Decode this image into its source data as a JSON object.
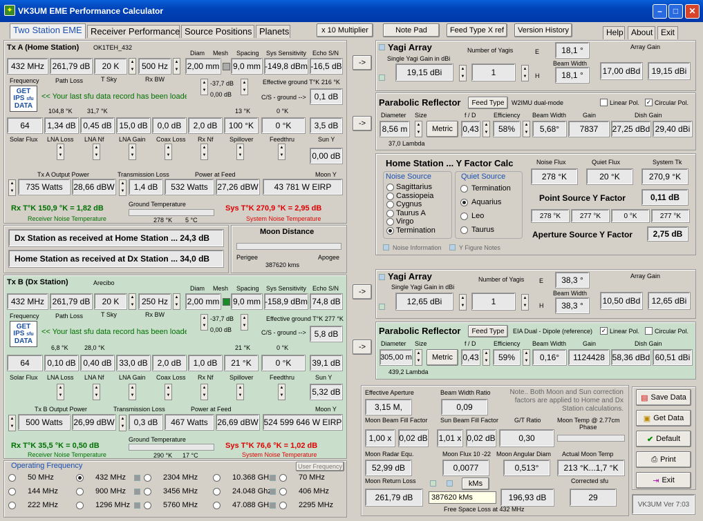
{
  "window": {
    "title": "VK3UM EME Performance Calculator",
    "icon": "app-icon"
  },
  "tabs": [
    "Two Station EME",
    "Receiver Performance",
    "Source Positions",
    "Planets"
  ],
  "toolbar": {
    "mult": "x 10 Multiplier",
    "notepad": "Note Pad",
    "feed": "Feed Type X ref",
    "version": "Version History"
  },
  "menu": {
    "help": "Help",
    "about": "About",
    "exit": "Exit"
  },
  "tx_a": {
    "title": "Tx A (Home Station)",
    "callsign": "OK1TEH_432",
    "h_diam": "Diam",
    "h_mesh": "Mesh",
    "h_spacing": "Spacing",
    "h_sens": "Sys Sensitivity",
    "h_echo": "Echo S/N",
    "freq": "432 MHz",
    "pathloss": "261,79 dB",
    "tsky": "20 K",
    "rxbw": "500 Hz",
    "diam": "2,00 mm",
    "spacing": "9,0 mm",
    "sens": "-149,8 dBm",
    "echo": "-16,5 dB",
    "l_freq": "Frequency",
    "l_path": "Path Loss",
    "l_tsky": "T Sky",
    "l_rxbw": "Rx BW",
    "eff_a": "-37,7 dB",
    "eff_b": "0,00 dB",
    "eff_label": "Effective ground T°K 216 °K",
    "cs_label": "C/S - ground -->",
    "cs": "0,1 dB",
    "last": "<< Your last sfu data record has been loaded",
    "k1": "104,8 °K",
    "k2": "31,7 °K",
    "k3": "13 °K",
    "k4": "0 °K",
    "solar": "64",
    "lnaloss": "1,34 dB",
    "lnanf": "0,45 dB",
    "lnagain": "15,0 dB",
    "coax": "0,0 dB",
    "rxnf": "2,0 dB",
    "spill": "100 °K",
    "feedthru": "0 °K",
    "suny": "3,5 dB",
    "l_solar": "Solar Flux",
    "l_lnaloss": "LNA Loss",
    "l_lnanf": "LNA Nf",
    "l_lnagain": "LNA Gain",
    "l_coax": "Coax Loss",
    "l_rxnf": "Rx Nf",
    "l_spill": "Spillover",
    "l_feed": "Feedthru",
    "l_suny": "Sun Y",
    "extra": "0,00 dB",
    "l_txout": "Tx A Output Power",
    "l_trans": "Transmission Loss",
    "l_paf": "Power at Feed",
    "l_moony": "Moon Y",
    "watts": "735 Watts",
    "dbw": "28,66 dBW",
    "trans": "1,4 dB",
    "pafw": "532 Watts",
    "pafdbw": "27,26 dBW",
    "eirp": "43 781 W EIRP",
    "rxt": "Rx T°K 150,9 °K = 1,82 dB",
    "rxt_l": "Receiver Noise Temperature",
    "gt": "Ground Temperature",
    "gk": "278 °K",
    "gc": "5 °C",
    "syst": "Sys T°K 270,9 °K = 2,95 dB",
    "syst_l": "System Noise Temperature"
  },
  "mid": {
    "dx_home": "Dx Station as received at Home Station ... 24,3 dB",
    "home_dx": "Home Station as received at Dx Station ... 34,0 dB",
    "moon_title": "Moon Distance",
    "perigee": "Perigee",
    "apogee": "Apogee",
    "kms": "387620 kms"
  },
  "tx_b": {
    "title": "Tx B (Dx Station)",
    "callsign": "Arecibo",
    "h_diam": "Diam",
    "h_mesh": "Mesh",
    "h_spacing": "Spacing",
    "h_sens": "Sys Sensitivity",
    "h_echo": "Echo S/N",
    "freq": "432 MHz",
    "pathloss": "261,79 dB",
    "tsky": "20 K",
    "rxbw": "250 Hz",
    "diam": "2,00 mm",
    "spacing": "9,0 mm",
    "sens": "-158,9 dBm",
    "echo": "74,8 dB",
    "l_freq": "Frequency",
    "l_path": "Path Loss",
    "l_tsky": "T Sky",
    "l_rxbw": "Rx BW",
    "eff_a": "-37,7 dB",
    "eff_b": "0,00 dB",
    "eff_label": "Effective ground T°K 277 °K",
    "cs_label": "C/S - ground -->",
    "cs": "5,8 dB",
    "last": "<< Your last sfu data record has been loaded",
    "k1": "6,8 °K",
    "k2": "28,0 °K",
    "k3": "21 °K",
    "k4": "0 °K",
    "solar": "64",
    "lnaloss": "0,10 dB",
    "lnanf": "0,40 dB",
    "lnagain": "33,0 dB",
    "coax": "2,0 dB",
    "rxnf": "1,0 dB",
    "spill": "21 °K",
    "feedthru": "0 °K",
    "suny": "39,1 dB",
    "l_solar": "Solar Flux",
    "l_lnaloss": "LNA Loss",
    "l_lnanf": "LNA Nf",
    "l_lnagain": "LNA Gain",
    "l_coax": "Coax Loss",
    "l_rxnf": "Rx Nf",
    "l_spill": "Spillover",
    "l_feed": "Feedthru",
    "l_suny": "Sun Y",
    "extra": "5,32 dB",
    "l_txout": "Tx B Output Power",
    "l_trans": "Transmission Loss",
    "l_paf": "Power at Feed",
    "l_moony": "Moon Y",
    "watts": "500 Watts",
    "dbw": "26,99 dBW",
    "trans": "0,3 dB",
    "pafw": "467 Watts",
    "pafdbw": "26,69 dBW",
    "eirp": "524 599 646 W EIRP",
    "rxt": "Rx T°K 35,5 °K = 0,50 dB",
    "rxt_l": "Receiver Noise Temperature",
    "gt": "Ground Temperature",
    "gk": "290 °K",
    "gc": "17 °C",
    "syst": "Sys T°K 76,6 °K = 1,02 dB",
    "syst_l": "System Noise Temperature"
  },
  "ipslogo": {
    "l1": "GET",
    "l2": "IPS",
    "l3": "sfu",
    "l4": "DATA"
  },
  "arrow": "->",
  "yagi_a": {
    "title": "Yagi Array",
    "single": "Single Yagi Gain in dBi",
    "gain": "19,15 dBi",
    "l_num": "Number of Yagis",
    "num": "1",
    "e_l": "E",
    "e": "18,1 °",
    "bw_l": "Beam Width",
    "h_l": "H",
    "h": "18,1 °",
    "ag_l": "Array Gain",
    "ag1": "17,00 dBd",
    "ag2": "19,15 dBi"
  },
  "para_a": {
    "title": "Parabolic Reflector",
    "feedtype": "Feed Type",
    "feedname": "W2IMU dual-mode",
    "linear": "Linear Pol.",
    "circular": "Circular Pol.",
    "l_diam": "Diameter",
    "l_size": "Size",
    "l_fd": "f / D",
    "l_eff": "Efficiency",
    "l_bw": "Beam Width",
    "l_gain": "Gain",
    "l_dish": "Dish Gain",
    "diam": "8,56 m",
    "metric": "Metric",
    "fd": "0,43",
    "eff": "58%",
    "bw": "5,68°",
    "gain": "7837",
    "dg1": "27,25 dBd",
    "dg2": "29,40 dBi",
    "lambda": "37,0 Lambda"
  },
  "ycalc": {
    "title": "Home Station ... Y Factor Calc",
    "noise_src": "Noise Source",
    "quiet_src": "Quiet Source",
    "noise": [
      "Sagittarius",
      "Cassiopeia",
      "Cygnus",
      "Taurus A",
      "Virgo",
      "Termination"
    ],
    "quiet": [
      "Termination",
      "Aquarius",
      "Leo",
      "Taurus"
    ],
    "l_nflux": "Noise Flux",
    "l_qflux": "Quiet Flux",
    "l_systk": "System Tk",
    "nflux": "278 °K",
    "qflux": "20 °K",
    "systk": "270,9 °K",
    "psy_l": "Point Source Y Factor",
    "psy": "0,11 dB",
    "k1": "278 °K",
    "k2": "277 °K",
    "k3": "0 °K",
    "k4": "277 °K",
    "asy_l": "Aperture Source Y Factor",
    "asy": "2,75 dB",
    "noise_info": "Noise Information",
    "yfig": "Y Figure Notes"
  },
  "yagi_b": {
    "title": "Yagi Array",
    "single": "Single Yagi Gain in dBi",
    "gain": "12,65 dBi",
    "l_num": "Number of Yagis",
    "num": "1",
    "e_l": "E",
    "e": "38,3 °",
    "bw_l": "Beam Width",
    "h_l": "H",
    "h": "38,3 °",
    "ag_l": "Array Gain",
    "ag1": "10,50 dBd",
    "ag2": "12,65 dBi"
  },
  "para_b": {
    "title": "Parabolic Reflector",
    "feedtype": "Feed Type",
    "feedname": "EIA Dual - Dipole (reference)",
    "linear": "Linear Pol.",
    "circular": "Circular Pol.",
    "l_diam": "Diameter",
    "l_size": "Size",
    "l_fd": "f / D",
    "l_eff": "Efficiency",
    "l_bw": "Beam Width",
    "l_gain": "Gain",
    "l_dish": "Dish Gain",
    "diam": "305,00 m",
    "metric": "Metric",
    "fd": "0,43",
    "eff": "59%",
    "bw": "0,16°",
    "gain": "1124428",
    "dg1": "58,36 dBd",
    "dg2": "60,51 dBi",
    "lambda": "439,2 Lambda"
  },
  "moon": {
    "l_ea": "Effective Aperture",
    "ea": "3,15 M,",
    "l_bwr": "Beam Width Ratio",
    "bwr": "0,09",
    "note": "Note.. Both Moon and Sun correction factors are applied to Home and Dx Station calculations.",
    "l_mbff": "Moon Beam Fill Factor",
    "mb1": "1,00 x",
    "mb2": "0,02 dB",
    "l_sbff": "Sun Beam Fill Factor",
    "sb1": "1,01 x",
    "sb2": "0,02 dB",
    "l_gt": "G/T Ratio",
    "gt": "0,30",
    "l_mt": "Moon Temp @ 2.77cm",
    "phase": "Phase",
    "l_mre": "Moon Radar Equ.",
    "mre": "52,99 dB",
    "l_mf": "Moon Flux 10 -22",
    "mf": "0,0077",
    "l_mad": "Moon Angular Diam",
    "mad": "0,513°",
    "l_amt": "Actual Moon Temp",
    "amt": "213 °K...1,7 °K",
    "l_mrl": "Moon Return Loss",
    "mrl": "261,79 dB",
    "kms_btn": "kMs",
    "kms": "387620 kMs",
    "fsl": "196,93 dB",
    "l_fsl": "Free Space Loss at 432 MHz",
    "l_csfu": "Corrected sfu",
    "csfu": "29"
  },
  "actions": {
    "save": "Save Data",
    "get": "Get Data",
    "default": "Default",
    "print": "Print",
    "exit": "Exit",
    "version": "VK3UM Ver 7:03"
  },
  "opfreq": {
    "title": "Operating Frequency",
    "user": "User Frequency",
    "col1": [
      "50 MHz",
      "144 MHz",
      "222 MHz"
    ],
    "col2": [
      "432 MHz",
      "900 MHz",
      "1296 MHz"
    ],
    "col3": [
      "2304 MHz",
      "3456 MHz",
      "5760 MHz"
    ],
    "col4": [
      "10.368 GHz",
      "24.048 Ghz",
      "47.088 GHz"
    ],
    "col5": [
      "70 MHz",
      "406 MHz",
      "2295 MHz"
    ]
  }
}
